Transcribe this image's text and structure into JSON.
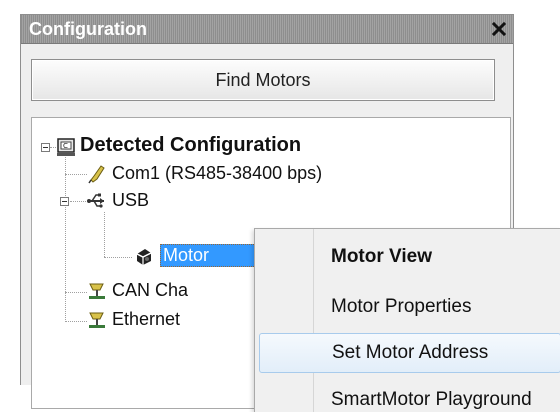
{
  "panel": {
    "title": "Configuration",
    "close_icon": "close-icon",
    "find_button": "Find Motors"
  },
  "tree": {
    "root": {
      "label": "Detected Configuration",
      "icon": "computer-icon",
      "expanded": true
    },
    "children": [
      {
        "label": "Com1 (RS485-38400 bps)",
        "icon": "serial-port-icon"
      },
      {
        "label": "USB",
        "icon": "usb-icon",
        "expanded": true,
        "children": [
          {
            "label": "Motor",
            "icon": "motor-icon",
            "selected": true
          }
        ]
      },
      {
        "label": "CAN Cha",
        "icon": "network-icon"
      },
      {
        "label": "Ethernet",
        "icon": "network-icon"
      }
    ]
  },
  "context_menu": {
    "items": [
      {
        "label": "Motor View",
        "bold": true
      },
      {
        "label": "Motor Properties"
      },
      {
        "label": "Set Motor Address",
        "hovered": true
      },
      {
        "label": "SmartMotor Playground"
      }
    ]
  },
  "colors": {
    "selection": "#3399ff",
    "menu_hover_border": "#a8cbec",
    "panel_bg": "#efefef"
  }
}
